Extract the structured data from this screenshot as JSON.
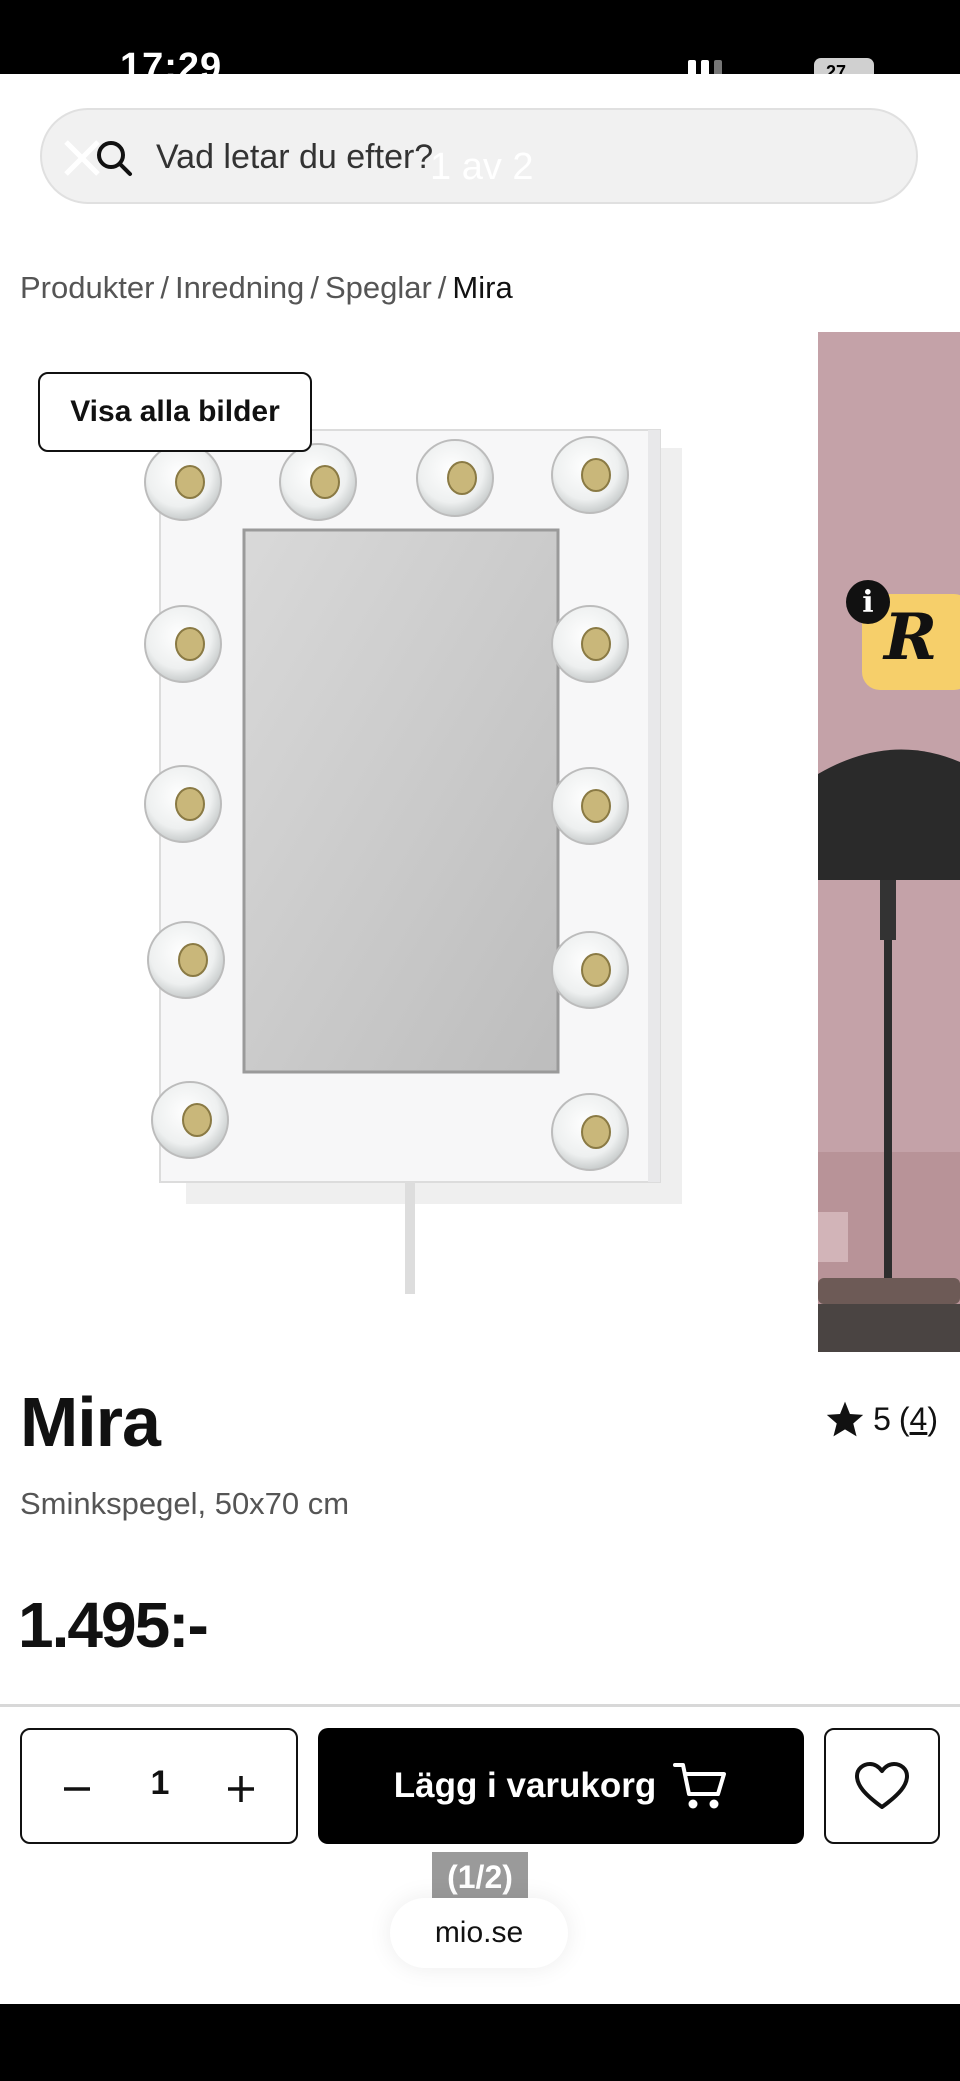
{
  "status": {
    "time": "17:29",
    "battery": "27"
  },
  "search": {
    "placeholder": "Vad letar du efter?",
    "counter": "1 av 2"
  },
  "breadcrumb": [
    "Produkter",
    "Inredning",
    "Speglar",
    "Mira"
  ],
  "gallery": {
    "view_all_label": "Visa alla bilder",
    "info_label": "i",
    "badge_letter": "R"
  },
  "product": {
    "name": "Mira",
    "rating": "5",
    "review_count": "4",
    "subtitle": "Sminkspegel, 50x70 cm",
    "price": "1.495:-"
  },
  "actions": {
    "quantity": "1",
    "add_to_cart_label": "Lägg i varukorg"
  },
  "browser": {
    "pager": "(1/2)",
    "domain": "mio.se"
  },
  "icons": [
    "search-icon",
    "close-icon",
    "star-icon",
    "minus-icon",
    "plus-icon",
    "cart-icon",
    "heart-icon"
  ],
  "colors": {
    "accent": "#000000",
    "badge": "#f6cf6a"
  }
}
